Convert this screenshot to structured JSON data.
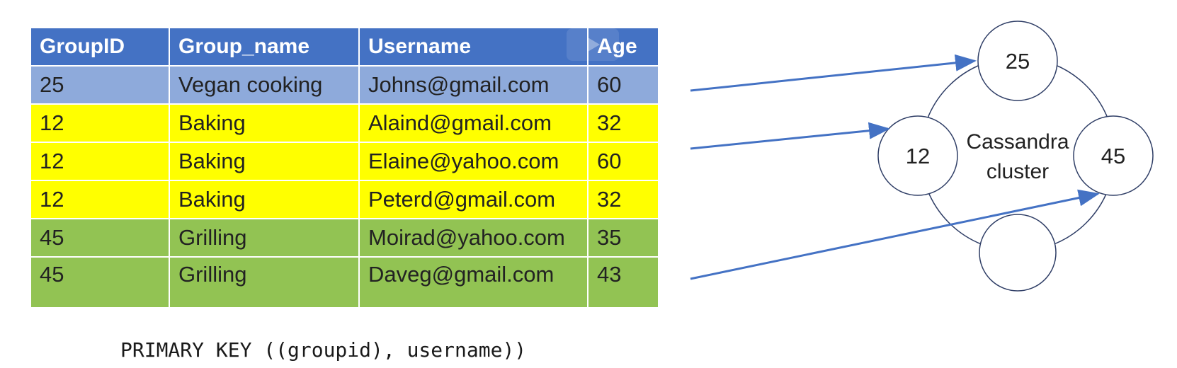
{
  "table": {
    "headers": [
      "GroupID",
      "Group_name",
      "Username",
      "Age"
    ],
    "rows": [
      {
        "group_id": "25",
        "group_name": "Vegan cooking",
        "username": "Johns@gmail.com",
        "age": "60",
        "color": "#8eaadb"
      },
      {
        "group_id": "12",
        "group_name": "Baking",
        "username": "Alaind@gmail.com",
        "age": "32",
        "color": "#ffff00"
      },
      {
        "group_id": "12",
        "group_name": "Baking",
        "username": "Elaine@yahoo.com",
        "age": "60",
        "color": "#ffff00"
      },
      {
        "group_id": "12",
        "group_name": "Baking",
        "username": "Peterd@gmail.com",
        "age": "32",
        "color": "#ffff00"
      },
      {
        "group_id": "45",
        "group_name": "Grilling",
        "username": "Moirad@yahoo.com",
        "age": "35",
        "color": "#92c353"
      },
      {
        "group_id": "45",
        "group_name": "Grilling",
        "username": "Daveg@gmail.com",
        "age": "43",
        "color": "#92c353"
      }
    ]
  },
  "primary_key": "PRIMARY KEY ((groupid), username))",
  "cluster": {
    "label_line1": "Cassandra",
    "label_line2": "cluster",
    "nodes": [
      "25",
      "12",
      "45",
      ""
    ]
  },
  "colors": {
    "header": "#4472c4",
    "arrow": "#4472c4",
    "outline": "#2f3e66"
  },
  "icons": [
    "play-icon"
  ]
}
